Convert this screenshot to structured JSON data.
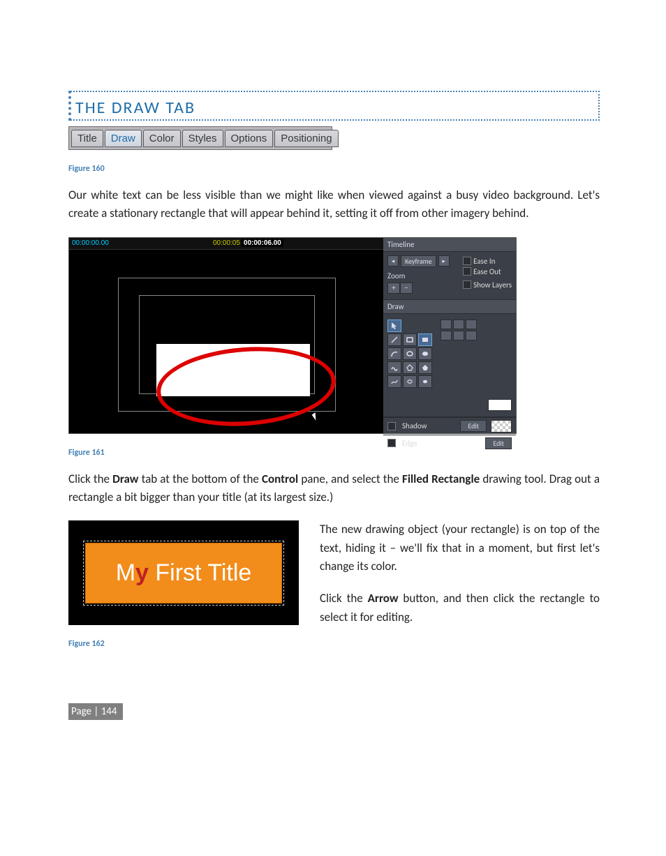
{
  "section_heading": "THE DRAW TAB",
  "fig160": {
    "caption": "Figure 160",
    "tabs": [
      "Title",
      "Draw",
      "Color",
      "Styles",
      "Options",
      "Positioning"
    ],
    "active_index": 1
  },
  "para1": "Our white text can be less visible than we might like when viewed against a busy video background.  Let's create a stationary rectangle that will appear behind it, setting it off from other imagery behind.",
  "fig161": {
    "caption": "Figure 161",
    "ruler": {
      "start": "00:00:00.00",
      "mid": "00:00:05",
      "end": "00:00:06.00"
    },
    "panels": {
      "timeline_header": "Timeline",
      "keyframe": "Keyframe",
      "ease_in": "Ease In",
      "ease_out": "Ease Out",
      "zoom": "Zoom",
      "show_layers": "Show Layers",
      "draw_header": "Draw",
      "shadow": "Shadow",
      "edge": "Edge",
      "edit": "Edit"
    }
  },
  "para2_parts": {
    "a": "Click the ",
    "b": "Draw",
    "c": " tab at the bottom of the ",
    "d": "Control",
    "e": " pane, and select the ",
    "f": "Filled Rectangle",
    "g": " drawing tool.  Drag out a rectangle a bit bigger than your title (at its largest size.)"
  },
  "fig162": {
    "caption": "Figure 162",
    "title_prefix": "M",
    "title_mid": "y",
    "title_rest": " First Title"
  },
  "para3": "The new drawing object (your rectangle) is on top of the text, hiding it – we'll fix that in a moment, but first let's change its color.",
  "para4_parts": {
    "a": "Click the ",
    "b": "Arrow",
    "c": " button, and then click the rectangle to select it for editing."
  },
  "page_number": "Page | 144"
}
